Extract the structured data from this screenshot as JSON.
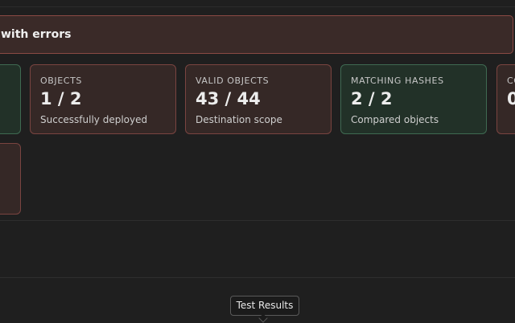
{
  "banner": {
    "text": "with errors"
  },
  "cards": [
    {
      "label": "OBJECTS",
      "value": "1 / 2",
      "sub": "Successfully deployed",
      "status": "error"
    },
    {
      "label": "VALID OBJECTS",
      "value": "43 / 44",
      "sub": "Destination scope",
      "status": "error"
    },
    {
      "label": "MATCHING HASHES",
      "value": "2 / 2",
      "sub": "Compared objects",
      "status": "ok"
    },
    {
      "label": "CO",
      "value": "0",
      "status": "error"
    }
  ],
  "tooltip": {
    "text": "Test Results"
  },
  "colors": {
    "error_border": "#7a4440",
    "error_bg": "#352826",
    "ok_border": "#3f6a52",
    "ok_bg": "#223128",
    "page_bg": "#1f1f1f"
  }
}
